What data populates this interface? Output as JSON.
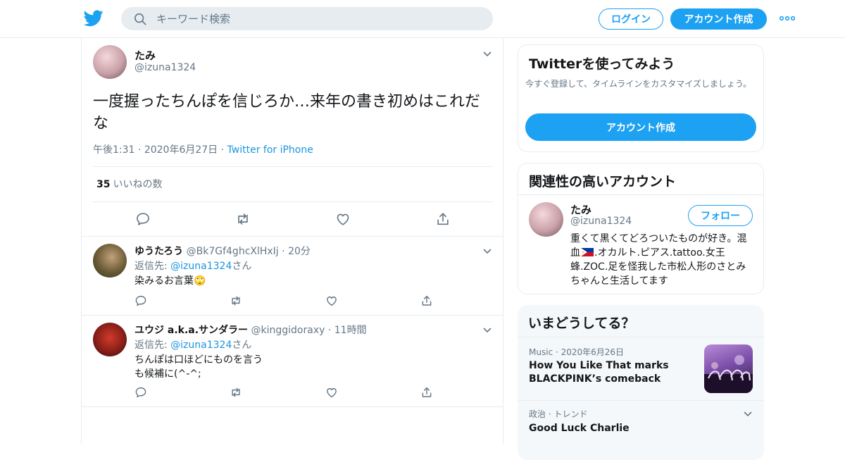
{
  "search": {
    "placeholder": "キーワード検索"
  },
  "header": {
    "login_label": "ログイン",
    "signup_label": "アカウント作成"
  },
  "main_tweet": {
    "name": "たみ",
    "handle": "@izuna1324",
    "text": "一度握ったちんぽを信じろか…来年の書き初めはこれだな",
    "time": "午後1:31",
    "date": "2020年6月27日",
    "source": "Twitter for iPhone",
    "like_count": "35",
    "like_label": "いいねの数"
  },
  "replies": [
    {
      "name": "ゆうたろう",
      "handle": "@Bk7Gf4ghcXlHxIj",
      "age": "20分",
      "reply_to_prefix": "返信先: ",
      "reply_to": "@izuna1324",
      "reply_to_suffix": "さん",
      "text": "染みるお言葉🙄"
    },
    {
      "name": "ユウジ a.k.a.サンダラー",
      "handle": "@kinggidoraxy",
      "age": "11時間",
      "reply_to_prefix": "返信先: ",
      "reply_to": "@izuna1324",
      "reply_to_suffix": "さん",
      "text": "ちんぽは口ほどにものを言う\nも候補に(^-^;"
    }
  ],
  "try_card": {
    "title": "Twitterを使ってみよう",
    "desc": "今すぐ登録して、タイムラインをカスタマイズしましょう。",
    "button": "アカウント作成"
  },
  "related": {
    "title": "関連性の高いアカウント",
    "name": "たみ",
    "handle": "@izuna1324",
    "follow": "フォロー",
    "bio_a": "重くて黒くてどろついたものが好き。混血",
    "bio_b": ".オカルト.ピアス.tattoo.女王蜂.ZOC.足を怪我した市松人形のさとみちゃんと生活してます"
  },
  "trends": {
    "title": "いまどうしてる？",
    "items": [
      {
        "category": "Music",
        "date": "2020年6月26日",
        "title": "How You Like That marks BLACKPINK’s comeback"
      },
      {
        "category": "政治 · トレンド",
        "title": "Good Luck Charlie"
      }
    ]
  },
  "colors": {
    "accent": "#1da1f2",
    "link": "#1b95e0",
    "secondary_text": "#657786",
    "border": "#e6ecf0"
  },
  "icons": [
    "twitter-bird-icon",
    "search-icon",
    "more-icon",
    "chevron-down-icon",
    "reply-icon",
    "retweet-icon",
    "like-icon",
    "share-icon",
    "philippines-flag-icon"
  ]
}
